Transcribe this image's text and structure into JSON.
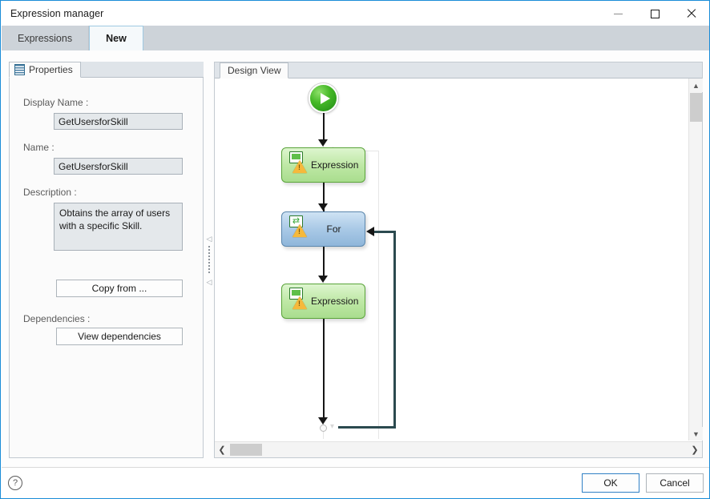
{
  "window": {
    "title": "Expression manager",
    "controls": {
      "minimize": "—",
      "maximize": "□",
      "close": "✕"
    }
  },
  "tabs": [
    {
      "label": "Expressions",
      "active": false
    },
    {
      "label": "New",
      "active": true
    }
  ],
  "properties_panel": {
    "tab_label": "Properties",
    "fields": {
      "display_name_label": "Display Name :",
      "display_name_value": "GetUsersforSkill",
      "name_label": "Name :",
      "name_value": "GetUsersforSkill",
      "description_label": "Description :",
      "description_value": "Obtains the array of users with a specific Skill."
    },
    "copy_from_button": "Copy from ...",
    "dependencies_label": "Dependencies :",
    "view_dependencies_button": "View dependencies"
  },
  "splitter": {
    "collapse_up": "◁",
    "collapse_down": "◁"
  },
  "design_panel": {
    "tab_label": "Design View",
    "nodes": [
      {
        "type": "start",
        "label": ""
      },
      {
        "type": "expression",
        "label": "Expression"
      },
      {
        "type": "for",
        "label": "For"
      },
      {
        "type": "expression",
        "label": "Expression"
      }
    ],
    "vscroll": {
      "up": "▲",
      "down": "▼"
    },
    "hscroll": {
      "left": "❮",
      "right": "❯"
    }
  },
  "footer": {
    "help": "?",
    "ok_button": "OK",
    "cancel_button": "Cancel"
  },
  "colors": {
    "window_border": "#1a8cd8",
    "tabstrip_bg": "#cdd3d9",
    "start_node_green": "#45b827",
    "expression_node_green": "#bfe8a6",
    "for_node_blue": "#a9c9e6",
    "warning_amber": "#f6b93b",
    "loop_line": "#2b4a4f",
    "input_bg": "#e4e8eb"
  }
}
